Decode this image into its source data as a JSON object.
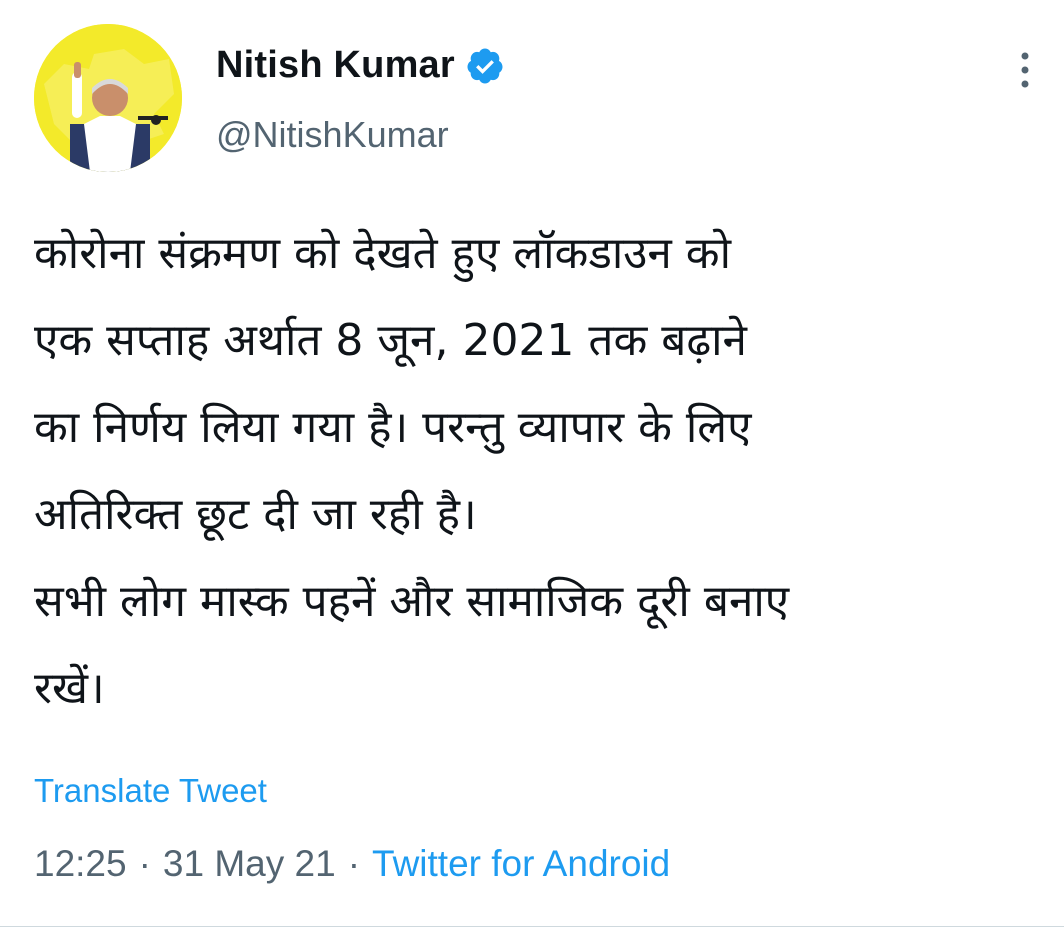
{
  "author": {
    "display_name": "Nitish Kumar",
    "handle": "@NitishKumar",
    "verified": true,
    "verified_color": "#1d9bf0",
    "avatar_background": "#f3ea2a"
  },
  "tweet": {
    "lines": [
      "कोरोना संक्रमण को देखते हुए लॉकडाउन को",
      "एक सप्ताह अर्थात 8 जून, 2021 तक बढ़ाने",
      "का निर्णय लिया गया है। परन्तु व्यापार के लिए",
      "अतिरिक्त छूट दी जा रही है।",
      "सभी लोग मास्क पहनें और सामाजिक दूरी बनाए",
      "रखें।"
    ]
  },
  "translate_label": "Translate Tweet",
  "meta": {
    "time": "12:25",
    "separator": "·",
    "date": "31 May 21",
    "source": "Twitter for Android"
  },
  "icons": {
    "more": "more-vertical-icon",
    "verified": "verified-badge-icon"
  }
}
